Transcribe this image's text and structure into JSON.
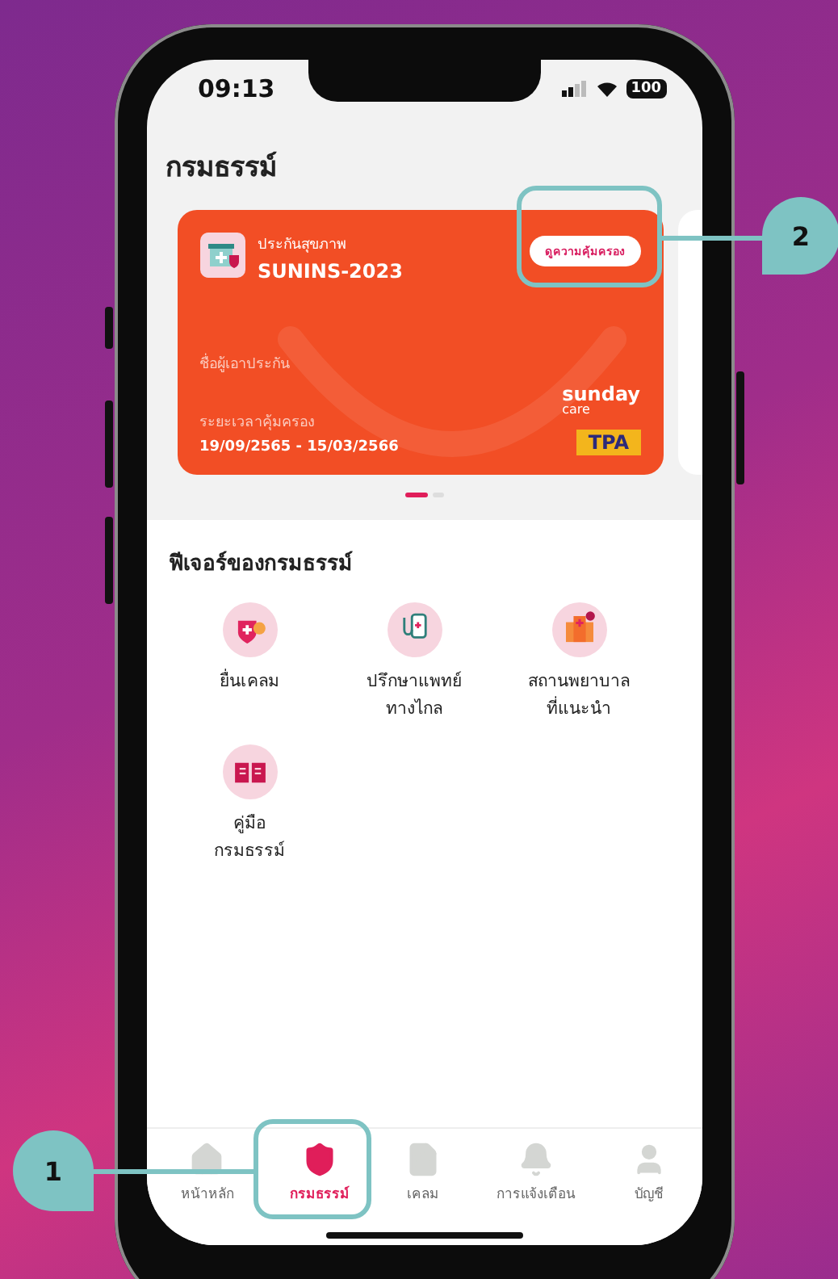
{
  "status_bar": {
    "time": "09:13",
    "battery": "100"
  },
  "title": "กรมธรรม์",
  "policy_card": {
    "type": "ประกันสุขภาพ",
    "name": "SUNINS-2023",
    "button": "ดูความคุ้มครอง",
    "insured_label": "ชื่อผู้เอาประกัน",
    "period_label": "ระยะเวลาคุ้มครอง",
    "period": "19/09/2565 - 15/03/2566",
    "brand": "sunday",
    "brand_sub": "care",
    "badge": "TPA"
  },
  "pager": [
    {
      "selected": true
    },
    {
      "selected": false
    }
  ],
  "features": {
    "heading": "ฟีเจอร์ของกรมธรรม์",
    "items": [
      {
        "kind": "claim",
        "label": "ยื่นเคลม"
      },
      {
        "kind": "doctor",
        "label": "ปรึกษาแพทย์\nทางไกล"
      },
      {
        "kind": "hospital",
        "label": "สถานพยาบาล\nที่แนะนำ"
      },
      {
        "kind": "manual",
        "label": "คู่มือ\nกรมธรรม์"
      }
    ]
  },
  "tab_bar": [
    {
      "kind": "home",
      "label": "หน้าหลัก",
      "selected": false
    },
    {
      "kind": "policy",
      "label": "กรมธรรม์",
      "selected": true
    },
    {
      "kind": "claim",
      "label": "เคลม",
      "selected": false
    },
    {
      "kind": "alerts",
      "label": "การแจ้งเตือน",
      "selected": false
    },
    {
      "kind": "account",
      "label": "บัญชี",
      "selected": false
    }
  ],
  "callouts": [
    {
      "label": "1"
    },
    {
      "label": "2"
    }
  ]
}
